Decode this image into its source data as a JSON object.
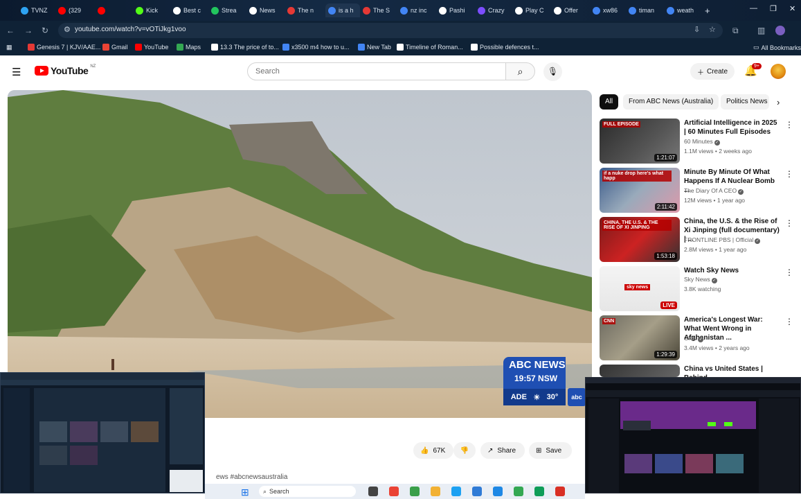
{
  "browser": {
    "tabs": [
      {
        "label": "TVNZ",
        "color": "#2ea3f2"
      },
      {
        "label": "(329",
        "color": "#ff0000"
      },
      {
        "label": "",
        "color": "#ff0000"
      },
      {
        "label": "Kick",
        "color": "#53fc18"
      },
      {
        "label": "Best c",
        "color": "#ffffff"
      },
      {
        "label": "Strea",
        "color": "#22c55e"
      },
      {
        "label": "News",
        "color": "#ffffff"
      },
      {
        "label": "The n",
        "color": "#e53935"
      },
      {
        "label": "is a h",
        "color": "#4285f4"
      },
      {
        "label": "The S",
        "color": "#e53935"
      },
      {
        "label": "nz inc",
        "color": "#4285f4"
      },
      {
        "label": "Pashi",
        "color": "#ffffff"
      },
      {
        "label": "Crazy",
        "color": "#7c4dff"
      },
      {
        "label": "Play C",
        "color": "#ffffff"
      },
      {
        "label": "Offer",
        "color": "#ffffff"
      },
      {
        "label": "xw86",
        "color": "#4285f4"
      },
      {
        "label": "timan",
        "color": "#4285f4"
      },
      {
        "label": "weath",
        "color": "#4285f4"
      }
    ],
    "new_tab": "+",
    "window_controls": {
      "minimize": "—",
      "maximize": "❐",
      "close": "✕"
    },
    "url": "youtube.com/watch?v=vOTiJkg1voo",
    "bookmarks": [
      {
        "label": "Genesis 7 | KJV/AAE...",
        "color": "#e53935"
      },
      {
        "label": "Gmail",
        "color": "#ea4335"
      },
      {
        "label": "YouTube",
        "color": "#ff0000"
      },
      {
        "label": "Maps",
        "color": "#34a853"
      },
      {
        "label": "13.3 The price of to...",
        "color": "#ffffff"
      },
      {
        "label": "x3500 m4 how to u...",
        "color": "#4285f4"
      },
      {
        "label": "New Tab",
        "color": "#4285f4"
      },
      {
        "label": "Timeline of Roman...",
        "color": "#ffffff"
      },
      {
        "label": "Possible defences t...",
        "color": "#ffffff"
      }
    ],
    "all_bookmarks": "All Bookmarks"
  },
  "youtube": {
    "logo_word": "YouTube",
    "country": "NZ",
    "search_placeholder": "Search",
    "create_label": "Create",
    "notifications": "9+"
  },
  "player": {
    "abc_brand": "ABC NEWS",
    "time": "19:57 NSW",
    "weather_city": "ADE",
    "weather_temp": "30°",
    "abc_mini": "abc"
  },
  "actions": {
    "likes": "67K",
    "share": "Share",
    "save": "Save",
    "hashtag": "ews #abcnewsaustralia"
  },
  "chips": [
    "All",
    "From ABC News (Australia)",
    "Politics News"
  ],
  "recommendations": [
    {
      "title": "Artificial Intelligence in 2025 | 60 Minutes Full Episodes",
      "channel": "60 Minutes",
      "meta": "1.1M views • 2 weeks ago",
      "duration": "1:21:07",
      "live": false,
      "badge": "FULL EPISODE"
    },
    {
      "title": "Minute By Minute Of What Happens If A Nuclear Bomb ...",
      "channel": "The Diary Of A CEO",
      "meta": "12M views • 1 year ago",
      "duration": "2:11:42",
      "live": false,
      "badge": "if a nuke drop here's what happ"
    },
    {
      "title": "China, the U.S. & the Rise of Xi Jinping (full documentary) | ...",
      "channel": "FRONTLINE PBS | Official",
      "meta": "2.8M views • 1 year ago",
      "duration": "1:53:18",
      "live": false,
      "badge": "CHINA, THE U.S. & THE RISE OF XI JINPING"
    },
    {
      "title": "Watch Sky News",
      "channel": "Sky News",
      "meta": "3.8K watching",
      "duration": "LIVE",
      "live": true,
      "badge": "sky news"
    },
    {
      "title": "America's Longest War: What Went Wrong in Afghanistan ...",
      "channel": "CNN",
      "meta": "3.4M views • 2 years ago",
      "duration": "1:29:39",
      "live": false,
      "badge": "CNN"
    },
    {
      "title": "China vs United States | Behind",
      "channel": "",
      "meta": "",
      "duration": "",
      "live": false,
      "badge": ""
    }
  ],
  "taskbar": {
    "search": "Search"
  }
}
